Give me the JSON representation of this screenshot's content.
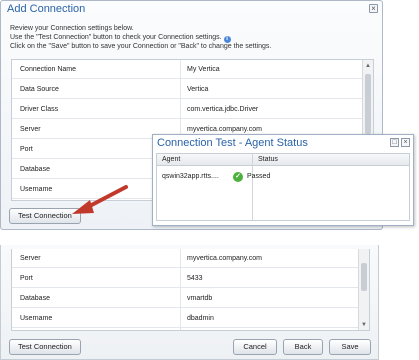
{
  "dialog": {
    "title": "Add Connection",
    "close_glyph": "×",
    "instructions": [
      "Review your Connection settings below.",
      "Use the \"Test Connection\" button to check your Connection settings.",
      "Click on the \"Save\" button to save your Connection or \"Back\" to change the settings."
    ],
    "info_glyph": "i",
    "rows": [
      {
        "label": "Connection Name",
        "value": "My Vertica"
      },
      {
        "label": "Data Source",
        "value": "Vertica"
      },
      {
        "label": "Driver Class",
        "value": "com.vertica.jdbc.Driver"
      },
      {
        "label": "Server",
        "value": "myvertica.company.com"
      },
      {
        "label": "Port",
        "value": ""
      },
      {
        "label": "Database",
        "value": ""
      },
      {
        "label": "Username",
        "value": ""
      }
    ],
    "test_button": "Test Connection"
  },
  "agent_popup": {
    "title": "Connection Test - Agent Status",
    "col_agent": "Agent",
    "col_status": "Status",
    "agent": "qswin32app.rtts....",
    "status": "Passed",
    "status_color": "#4caf3e"
  },
  "dialog2": {
    "rows": [
      {
        "label": "Server",
        "value": "myvertica.company.com"
      },
      {
        "label": "Port",
        "value": "5433"
      },
      {
        "label": "Database",
        "value": "vmartdb"
      },
      {
        "label": "Username",
        "value": "dbadmin"
      }
    ],
    "test_button": "Test Connection",
    "cancel_button": "Cancel",
    "back_button": "Back",
    "save_button": "Save"
  },
  "colors": {
    "title": "#2a63a8",
    "arrow": "#c0392b"
  }
}
